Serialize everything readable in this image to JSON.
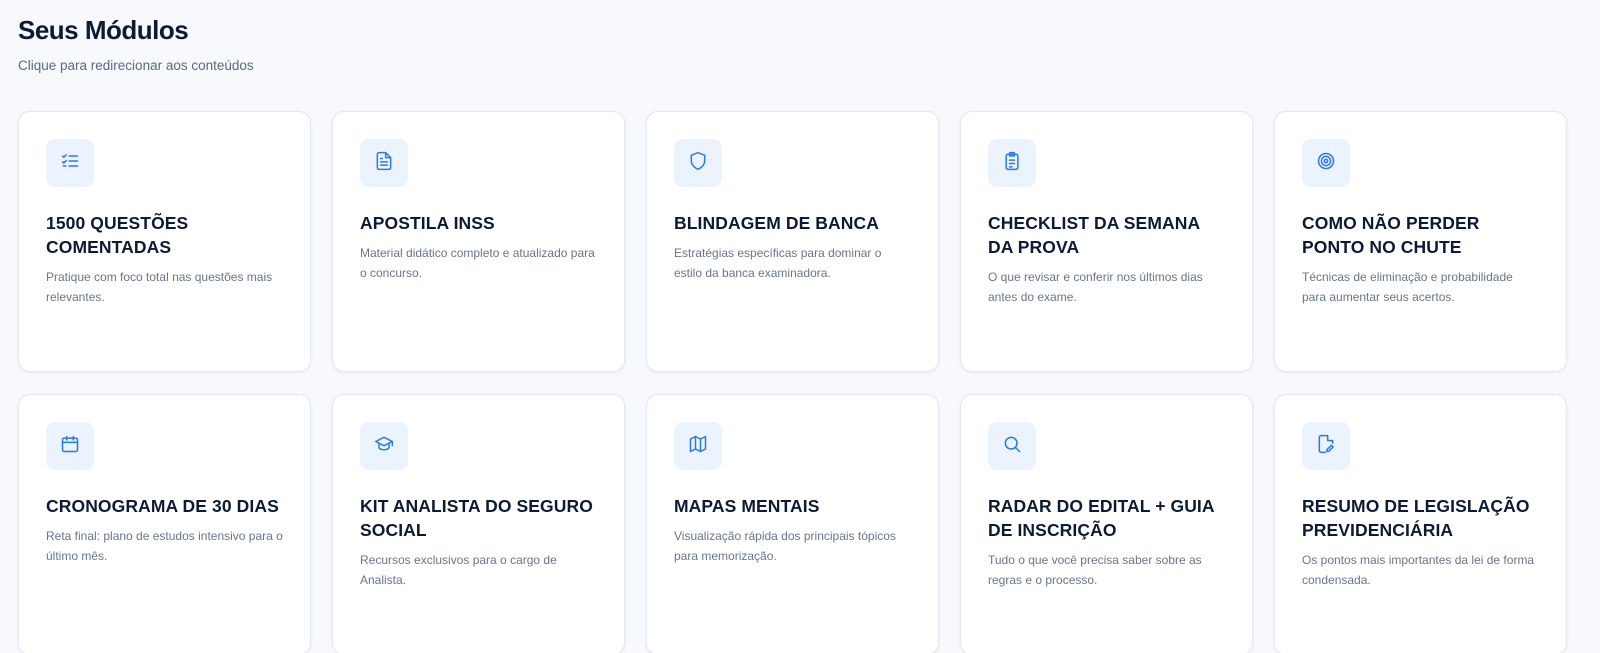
{
  "header": {
    "title": "Seus Módulos",
    "subtitle": "Clique para redirecionar aos conteúdos"
  },
  "accent_color": "#2f7ad6",
  "icon_bg_color": "#eaf3fe",
  "modules": [
    {
      "icon": "list-check-icon",
      "title": "1500 QUESTÕES COMENTADAS",
      "description": "Pratique com foco total nas questões mais relevantes."
    },
    {
      "icon": "document-icon",
      "title": "APOSTILA INSS",
      "description": "Material didático completo e atualizado para o concurso."
    },
    {
      "icon": "shield-icon",
      "title": "BLINDAGEM DE BANCA",
      "description": "Estratégias específicas para dominar o estilo da banca examinadora."
    },
    {
      "icon": "clipboard-icon",
      "title": "CHECKLIST DA SEMANA DA PROVA",
      "description": "O que revisar e conferir nos últimos dias antes do exame."
    },
    {
      "icon": "target-icon",
      "title": "COMO NÃO PERDER PONTO NO CHUTE",
      "description": "Técnicas de eliminação e probabilidade para aumentar seus acertos."
    },
    {
      "icon": "calendar-icon",
      "title": "CRONOGRAMA DE 30 DIAS",
      "description": "Reta final: plano de estudos intensivo para o último mês."
    },
    {
      "icon": "graduation-cap-icon",
      "title": "KIT ANALISTA DO SEGURO SOCIAL",
      "description": "Recursos exclusivos para o cargo de Analista."
    },
    {
      "icon": "map-icon",
      "title": "MAPAS MENTAIS",
      "description": "Visualização rápida dos principais tópicos para memorização."
    },
    {
      "icon": "search-icon",
      "title": "RADAR DO EDITAL + GUIA DE INSCRIÇÃO",
      "description": "Tudo o que você precisa saber sobre as regras e o processo."
    },
    {
      "icon": "file-edit-icon",
      "title": "RESUMO DE LEGISLAÇÃO PREVIDENCIÁRIA",
      "description": "Os pontos mais importantes da lei de forma condensada."
    }
  ]
}
